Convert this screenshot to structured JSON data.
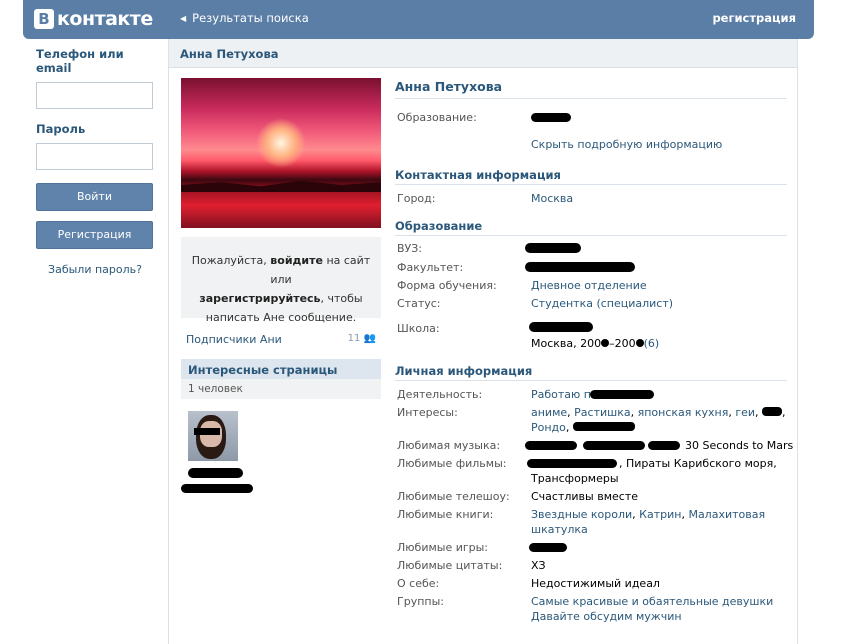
{
  "header": {
    "logo_letter": "В",
    "logo_text": "контакте",
    "back_label": "Результаты поиска",
    "register_link": "регистрация"
  },
  "login": {
    "phone_label": "Телефон или email",
    "password_label": "Пароль",
    "login_button": "Войти",
    "register_button": "Регистрация",
    "forgot_link": "Забыли пароль?"
  },
  "profile": {
    "bar_title": "Анна Петухова",
    "name": "Анна Петухова",
    "message_text_1": "Пожалуйста,",
    "message_login": "войдите",
    "message_text_2": "на сайт или",
    "message_register": "зарегистрируйтесь",
    "message_text_3": ", чтобы написать Ане сообщение.",
    "subscribers_label": "Подписчики Ани",
    "subscribers_count": "11",
    "interesting_title": "Интересные страницы",
    "interesting_count": "1 человек"
  },
  "info": {
    "education_label": "Образование:",
    "hide_details": "Скрыть подробную информацию",
    "contact_title": "Контактная информация",
    "city_label": "Город:",
    "city_value": "Москва",
    "education_title": "Образование",
    "university_label": "ВУЗ:",
    "faculty_label": "Факультет:",
    "study_form_label": "Форма обучения:",
    "study_form_value": "Дневное отделение",
    "status_label": "Статус:",
    "status_value": "Студентка (специалист)",
    "school_label": "Школа:",
    "school_city_value": "Москва, 200",
    "school_year_mid": "–200",
    "school_grade": "(6)",
    "personal_title": "Личная информация",
    "activity_label": "Деятельность:",
    "activity_value": "Работаю п",
    "interests_label": "Интересы:",
    "interests_1": "аниме",
    "interests_2": "Растишка",
    "interests_3": "японская кухня",
    "interests_4": "геи",
    "interests_5": "Рондо",
    "music_label": "Любимая музыка:",
    "music_value": "30 Seconds to Mars",
    "movies_label": "Любимые фильмы:",
    "movies_value_1": ", Пираты Карибского моря,",
    "movies_value_2": "Трансформеры",
    "tv_label": "Любимые телешоу:",
    "tv_value": "Счастливы вместе",
    "books_label": "Любимые книги:",
    "books_1": "Звездные короли",
    "books_2": "Катрин",
    "books_3": "Малахитовая",
    "books_3b": "шкатулка",
    "games_label": "Любимые игры:",
    "quotes_label": "Любимые цитаты:",
    "quotes_value": "ХЗ",
    "about_label": "О себе:",
    "about_value": "Недостижимый идеал",
    "groups_label": "Группы:",
    "group_1": "Самые красивые и обаятельные девушки",
    "group_2": "Давайте обсудим мужчин"
  }
}
